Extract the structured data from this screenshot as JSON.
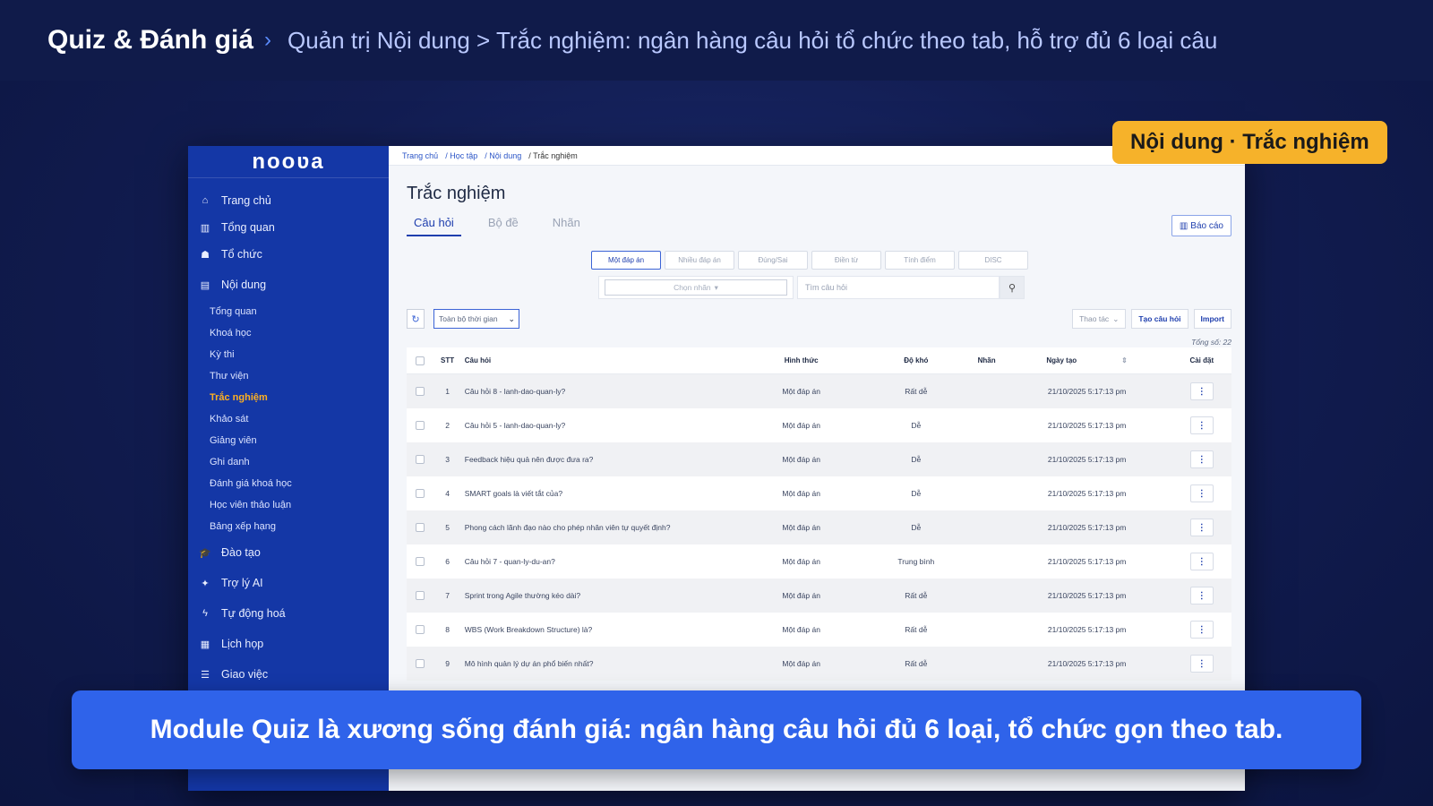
{
  "banner": {
    "title": "Quiz & Đánh giá",
    "separator": "›",
    "subtitle": "Quản trị Nội dung > Trắc nghiệm: ngân hàng câu hỏi tổ chức theo tab, hỗ trợ đủ 6 loại câu"
  },
  "badge": "Nội dung · Trắc nghiệm",
  "caption": "Module Quiz là xương sống đánh giá: ngân hàng câu hỏi đủ 6 loại, tổ chức gọn theo tab.",
  "app": {
    "logo": "nooʋa",
    "accent": "#1437a6",
    "highlight": "#ffb020"
  },
  "sidebar": {
    "items": [
      {
        "label": "Trang chủ",
        "icon": "home-icon"
      },
      {
        "label": "Tổng quan",
        "icon": "bar-chart-icon"
      },
      {
        "label": "Tổ chức",
        "icon": "org-chart-icon"
      },
      {
        "label": "Nội dung",
        "icon": "book-icon"
      }
    ],
    "subitems": [
      "Tổng quan",
      "Khoá học",
      "Kỳ thi",
      "Thư viện",
      "Trắc nghiệm",
      "Khảo sát",
      "Giảng viên",
      "Ghi danh",
      "Đánh giá khoá học",
      "Học viên thảo luận",
      "Bảng xếp hạng"
    ],
    "active_sub": "Trắc nghiệm",
    "bottom_items": [
      {
        "label": "Đào tạo",
        "icon": "graduation-cap-icon"
      },
      {
        "label": "Trợ lý AI",
        "icon": "sparkle-icon"
      },
      {
        "label": "Tự động hoá",
        "icon": "bolt-icon"
      },
      {
        "label": "Lịch họp",
        "icon": "calendar-icon"
      },
      {
        "label": "Giao việc",
        "icon": "list-icon"
      }
    ]
  },
  "breadcrumb": [
    "Trang chủ",
    "/ Học tập",
    "/ Nội dung",
    "/ Trắc nghiệm"
  ],
  "page": {
    "title": "Trắc nghiệm",
    "tabs": [
      "Câu hỏi",
      "Bộ đề",
      "Nhãn"
    ],
    "active_tab": "Câu hỏi",
    "report_label": "Báo cáo"
  },
  "question_types": [
    "Một đáp án",
    "Nhiều đáp án",
    "Đúng/Sai",
    "Điền từ",
    "Tính điểm",
    "DISC"
  ],
  "active_type": "Một đáp án",
  "filters": {
    "label_select": "Chọn nhãn",
    "search_placeholder": "Tìm câu hỏi",
    "period": "Toàn bộ thời gian"
  },
  "actions": {
    "more": "Thao tác",
    "create": "Tạo câu hỏi",
    "import": "Import"
  },
  "total_text": "Tổng số: 22",
  "table": {
    "headers": [
      "STT",
      "Câu hỏi",
      "Hình thức",
      "Độ khó",
      "Nhãn",
      "Ngày tạo",
      "Cài đặt"
    ],
    "rows": [
      {
        "stt": "1",
        "question": "Câu hỏi 8 - lanh-dao-quan-ly?",
        "type": "Một đáp án",
        "difficulty": "Rất dễ",
        "tag": "",
        "date": "21/10/2025 5:17:13 pm"
      },
      {
        "stt": "2",
        "question": "Câu hỏi 5 - lanh-dao-quan-ly?",
        "type": "Một đáp án",
        "difficulty": "Dễ",
        "tag": "",
        "date": "21/10/2025 5:17:13 pm"
      },
      {
        "stt": "3",
        "question": "Feedback hiệu quả nên được đưa ra?",
        "type": "Một đáp án",
        "difficulty": "Dễ",
        "tag": "",
        "date": "21/10/2025 5:17:13 pm"
      },
      {
        "stt": "4",
        "question": "SMART goals là viết tắt của?",
        "type": "Một đáp án",
        "difficulty": "Dễ",
        "tag": "",
        "date": "21/10/2025 5:17:13 pm"
      },
      {
        "stt": "5",
        "question": "Phong cách lãnh đạo nào cho phép nhân viên tự quyết định?",
        "type": "Một đáp án",
        "difficulty": "Dễ",
        "tag": "",
        "date": "21/10/2025 5:17:13 pm"
      },
      {
        "stt": "6",
        "question": "Câu hỏi 7 - quan-ly-du-an?",
        "type": "Một đáp án",
        "difficulty": "Trung bình",
        "tag": "",
        "date": "21/10/2025 5:17:13 pm"
      },
      {
        "stt": "7",
        "question": "Sprint trong Agile thường kéo dài?",
        "type": "Một đáp án",
        "difficulty": "Rất dễ",
        "tag": "",
        "date": "21/10/2025 5:17:13 pm"
      },
      {
        "stt": "8",
        "question": "WBS (Work Breakdown Structure) là?",
        "type": "Một đáp án",
        "difficulty": "Rất dễ",
        "tag": "",
        "date": "21/10/2025 5:17:13 pm"
      },
      {
        "stt": "9",
        "question": "Mô hình quản lý dự án phổ biến nhất?",
        "type": "Một đáp án",
        "difficulty": "Rất dễ",
        "tag": "",
        "date": "21/10/2025 5:17:13 pm"
      }
    ]
  }
}
